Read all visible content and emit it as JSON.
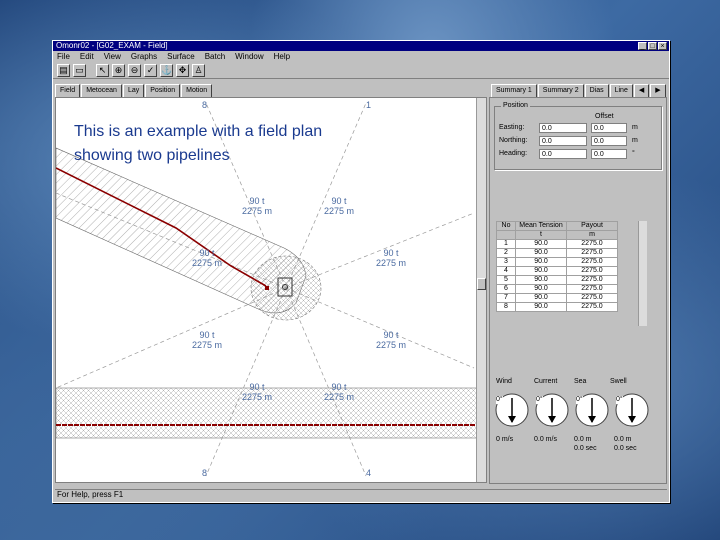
{
  "window": {
    "title": "Omonr02 - [G02_EXAM - Field]"
  },
  "menu": [
    "File",
    "Edit",
    "View",
    "Graphs",
    "Surface",
    "Batch",
    "Window",
    "Help"
  ],
  "toolbar": {
    "buttons": [
      {
        "icon": "printer-icon",
        "glyph": "▤"
      },
      {
        "icon": "open-icon",
        "glyph": "▭"
      },
      {
        "icon": "pointer-icon",
        "glyph": "↖"
      },
      {
        "icon": "zoom-in-icon",
        "glyph": "⊕"
      },
      {
        "icon": "zoom-out-icon",
        "glyph": "⊖"
      },
      {
        "icon": "check-icon",
        "glyph": "✓"
      },
      {
        "icon": "anchor-icon",
        "glyph": "⚓"
      },
      {
        "icon": "move-icon",
        "glyph": "✥"
      },
      {
        "icon": "person-icon",
        "glyph": "♙"
      }
    ]
  },
  "field_tabs": [
    "Field",
    "Metocean",
    "Lay",
    "Position",
    "Motion"
  ],
  "panel_tabs": [
    "Summary 1",
    "Summary 2",
    "Dias",
    "Line"
  ],
  "overlay": {
    "line1": "This is an example with a field plan",
    "line2": "showing two pipelines"
  },
  "field": {
    "marker_top_left": "8",
    "marker_top_right": "1",
    "marker_bottom_left": "8",
    "marker_bottom_right": "4",
    "line_labels": [
      {
        "t": "90 t",
        "m": "2275 m"
      },
      {
        "t": "90 t",
        "m": "2275 m"
      },
      {
        "t": "90 t",
        "m": "2275 m"
      },
      {
        "t": "90 t",
        "m": "2275 m"
      },
      {
        "t": "90 t",
        "m": "2275 m"
      },
      {
        "t": "90 t",
        "m": "2275 m"
      },
      {
        "t": "90 t",
        "m": "2275 m"
      },
      {
        "t": "90 t",
        "m": "2275 m"
      }
    ]
  },
  "position": {
    "title": "Position",
    "offset_header": "Offset",
    "rows": [
      {
        "label": "Easting:",
        "value": "0.0",
        "offset": "0.0",
        "unit": "m"
      },
      {
        "label": "Northing:",
        "value": "0.0",
        "offset": "0.0",
        "unit": "m"
      },
      {
        "label": "Heading:",
        "value": "0.0",
        "offset": "0.0",
        "unit": "°"
      }
    ]
  },
  "anchors": {
    "headers": [
      "No",
      "Mean Tension",
      "Payout"
    ],
    "units": [
      "",
      "t",
      "m"
    ],
    "rows": [
      [
        "1",
        "90.0",
        "2275.0"
      ],
      [
        "2",
        "90.0",
        "2275.0"
      ],
      [
        "3",
        "90.0",
        "2275.0"
      ],
      [
        "4",
        "90.0",
        "2275.0"
      ],
      [
        "5",
        "90.0",
        "2275.0"
      ],
      [
        "6",
        "90.0",
        "2275.0"
      ],
      [
        "7",
        "90.0",
        "2275.0"
      ],
      [
        "8",
        "90.0",
        "2275.0"
      ]
    ]
  },
  "gauges": [
    {
      "label": "Wind",
      "angle": "0°",
      "value": "0 m/s",
      "extra": ""
    },
    {
      "label": "Current",
      "angle": "0°",
      "value": "0.0 m/s",
      "extra": ""
    },
    {
      "label": "Sea",
      "angle": "0°",
      "value": "0.0 m",
      "extra": "0.0 sec"
    },
    {
      "label": "Swell",
      "angle": "0°",
      "value": "0.0 m",
      "extra": "0.0 sec"
    }
  ],
  "statusbar": {
    "text": "For Help, press F1"
  },
  "colors": {
    "title_bg": "#000080",
    "pipeline": "#8b0000",
    "overlay_text": "#1a3a8f"
  }
}
